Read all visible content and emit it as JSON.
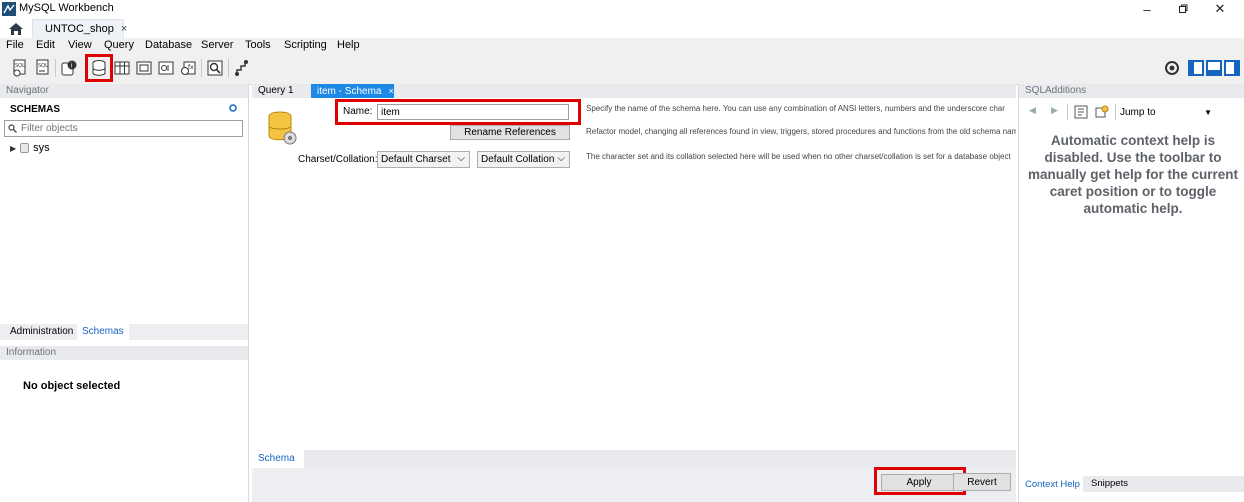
{
  "window": {
    "title": "MySQL Workbench"
  },
  "tabs": {
    "connection_tab": "UNTOC_shop",
    "close_glyph": "×"
  },
  "menu": [
    "File",
    "Edit",
    "View",
    "Query",
    "Database",
    "Server",
    "Tools",
    "Scripting",
    "Help"
  ],
  "navigator": {
    "title": "Navigator",
    "schemas_heading": "SCHEMAS",
    "filter_placeholder": "Filter objects",
    "schemas": [
      "sys"
    ],
    "bottom_tabs": [
      "Administration",
      "Schemas"
    ],
    "information_title": "Information",
    "info_text": "No object selected"
  },
  "editor": {
    "tabs": [
      "Query 1",
      "item - Schema"
    ],
    "name_label": "Name:",
    "name_value": "item",
    "rename_button": "Rename References",
    "charset_label": "Charset/Collation:",
    "charset_value": "Default Charset",
    "collation_value": "Default Collation",
    "help_name": "Specify the name of the schema here. You can use any combination of ANSI letters, numbers and the underscore char",
    "help_rename": "Refactor model, changing all references found in view, triggers, stored procedures and functions from the old schema name to the",
    "help_charset": "The character set and its collation selected here will be used when no other charset/collation is set for a database object",
    "bottom_tab": "Schema",
    "apply_button": "Apply",
    "revert_button": "Revert"
  },
  "sql_additions": {
    "title": "SQLAdditions",
    "jump_to": "Jump to",
    "help_text": "Automatic context help is disabled. Use the toolbar to manually get help for the current caret position or to toggle automatic help.",
    "bottom_tabs": [
      "Context Help",
      "Snippets"
    ]
  },
  "colors": {
    "accent": "#0078d7",
    "highlight": "#e10000",
    "panel": "#e8eaed"
  }
}
